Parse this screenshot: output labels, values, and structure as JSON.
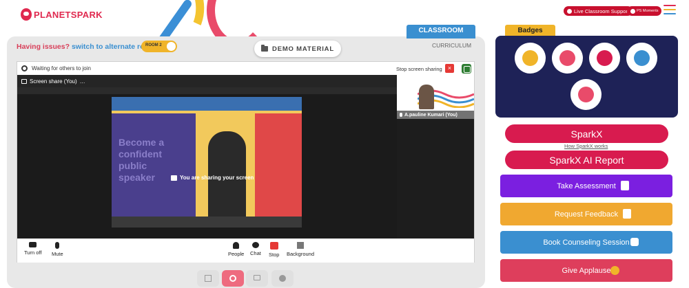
{
  "header": {
    "logo_text": "PLANETSPARK",
    "live_support_label": "Live Classroom Support",
    "ps_moments_label": "PS Moments"
  },
  "main": {
    "issues_text": "Having issues?",
    "alt_room_text": "switch to alternate room",
    "room_toggle_label": "ROOM 2",
    "demo_material_label": "DEMO MATERIAL",
    "classroom_tab": "CLASSROOM",
    "curriculum_label": "CURRICULUM"
  },
  "meeting": {
    "waiting_text": "Waiting for others to join",
    "stop_share_text": "Stop screen sharing",
    "screen_share_label": "Screen share (You)",
    "share_menu_glyph": "…",
    "sharing_message": "You are sharing your screen",
    "participant_name": "A.pauline Kumari (You)",
    "slide_text_line1": "Become a",
    "slide_text_line2": "confident",
    "slide_text_line3": "public",
    "slide_text_line4": "speaker",
    "controls": {
      "turn_off": "Turn off",
      "mute": "Mute",
      "people": "People",
      "chat": "Chat",
      "stop": "Stop",
      "background": "Background"
    }
  },
  "badges": {
    "title": "Badges",
    "items": [
      "badge-1",
      "badge-2",
      "badge-3",
      "badge-4",
      "badge-5"
    ]
  },
  "actions": {
    "sparkx": "SparkX",
    "how_sparkx": "How SparkX works",
    "sparkx_ai_report": "SparkX AI Report",
    "take_assessment": "Take Assessment",
    "request_feedback": "Request Feedback",
    "book_counseling": "Book Counseling Session",
    "give_applause": "Give Applause"
  },
  "colors": {
    "brand_red": "#d81b4f",
    "blue": "#3a8fd0",
    "purple": "#7b1fe0",
    "orange": "#f0a830",
    "applause_red": "#de3e5c",
    "badges_bg": "#1e2257"
  }
}
